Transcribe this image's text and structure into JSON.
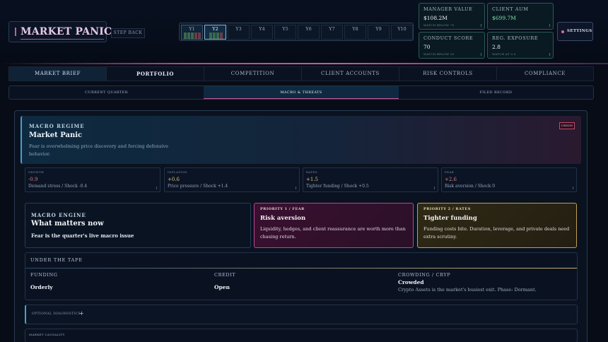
{
  "header": {
    "title": "MARKET PANIC",
    "step_back": "STEP BACK",
    "years": [
      {
        "label": "Y1",
        "state": "done"
      },
      {
        "label": "Y2",
        "state": "current"
      },
      {
        "label": "Y3",
        "state": "future"
      },
      {
        "label": "Y4",
        "state": "future"
      },
      {
        "label": "Y5",
        "state": "future"
      },
      {
        "label": "Y6",
        "state": "future"
      },
      {
        "label": "Y7",
        "state": "future"
      },
      {
        "label": "Y8",
        "state": "future"
      },
      {
        "label": "Y9",
        "state": "future"
      },
      {
        "label": "Y10",
        "state": "future"
      }
    ],
    "metrics": [
      {
        "label": "MANAGER VALUE",
        "value": "$108.2M",
        "sub": "WATCH BELOW 75"
      },
      {
        "label": "CLIENT AUM",
        "value": "$699.7M",
        "sub": ""
      },
      {
        "label": "CONDUCT SCORE",
        "value": "70",
        "sub": "WATCH BELOW 50"
      },
      {
        "label": "REG. EXPOSURE",
        "value": "2.8",
        "sub": "WATCH AT 3.0"
      }
    ],
    "settings": "SETTINGS"
  },
  "nav": {
    "tabs": [
      "MARKET BRIEF",
      "PORTFOLIO",
      "COMPETITION",
      "CLIENT ACCOUNTS",
      "RISK CONTROLS",
      "COMPLIANCE"
    ],
    "active": "MARKET BRIEF"
  },
  "subnav": {
    "tabs": [
      "CURRENT QUARTER",
      "MACRO & THREATS",
      "FILED RECORD"
    ],
    "active": "MACRO & THREATS"
  },
  "regime": {
    "kicker": "MACRO REGIME",
    "title": "Market Panic",
    "desc": "Fear is overwhelming price discovery and forcing defensive behavior.",
    "badge": "CRISIS"
  },
  "stats": [
    {
      "label": "GROWTH",
      "value": "-0.9",
      "sub": "Demand stress / Shock -0.4",
      "tone": "neg"
    },
    {
      "label": "INFLATION",
      "value": "+0.6",
      "sub": "Price pressure / Shock +1.4",
      "tone": "pos"
    },
    {
      "label": "RATES",
      "value": "+1.5",
      "sub": "Tighter funding / Shock +0.5",
      "tone": "pos"
    },
    {
      "label": "FEAR",
      "value": "+2.6",
      "sub": "Risk aversion / Shock 0",
      "tone": "neg"
    }
  ],
  "engine": {
    "kicker": "MACRO ENGINE",
    "title": "What matters now",
    "desc": "Fear is the quarter's live macro issue"
  },
  "priorities": [
    {
      "kicker": "PRIORITY 1 / FEAR",
      "title": "Risk aversion",
      "desc": "Liquidity, hedges, and client reassurance are worth more than chasing return."
    },
    {
      "kicker": "PRIORITY 2 / RATES",
      "title": "Tighter funding",
      "desc": "Funding costs bite. Duration, leverage, and private deals need extra scrutiny."
    }
  ],
  "tape": {
    "kicker": "UNDER THE TAPE",
    "cols": [
      {
        "label": "FUNDING",
        "value": "Orderly",
        "sub": ""
      },
      {
        "label": "CREDIT",
        "value": "Open",
        "sub": ""
      },
      {
        "label": "CROWDING / CRYP",
        "value": "Crowded",
        "sub": "Crypto Assets is the market's busiest exit. Phase: Dormant."
      }
    ]
  },
  "diagnostics": {
    "label": "OPTIONAL DIAGNOSTICS",
    "toggle": "+"
  },
  "causality": {
    "label": "MARKET CAUSALITY"
  },
  "colors": {
    "accent": "#c85aa0",
    "teal": "#2a5a56",
    "gold": "#c0a050",
    "blue": "#4aa0c8"
  }
}
